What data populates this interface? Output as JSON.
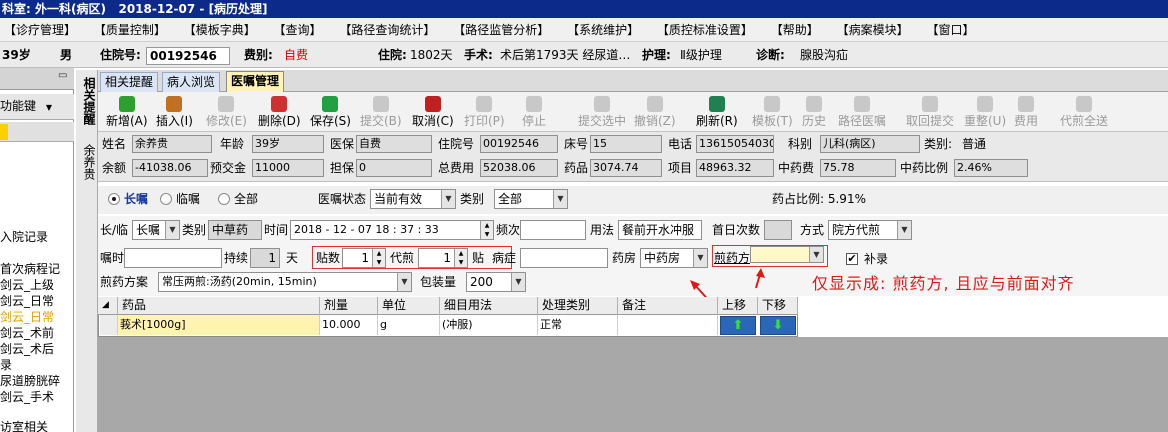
{
  "window": {
    "title": "科室: 外一科(病区)   2018-12-07 - [病历处理]"
  },
  "menu": [
    "【诊疗管理】",
    "【质量控制】",
    "【模板字典】",
    "【查询】",
    "【路径查询统计】",
    "【路径监管分析】",
    "【系统维护】",
    "【质控标准设置】",
    "【帮助】",
    "【病案模块】",
    "【窗口】"
  ],
  "patient": {
    "age": "39岁",
    "sex": "男",
    "admission_no_label": "住院号:",
    "admission_no": "00192546",
    "fee_type_label": "费别:",
    "fee_type": "自费",
    "stay_label": "住院:",
    "stay": "1802天",
    "surgery_label": "手术:",
    "surgery": "术后第1793天  经尿道…",
    "nursing_label": "护理:",
    "nursing": "Ⅱ级护理",
    "diagnosis_label": "诊断:",
    "diagnosis": "腺股沟疝"
  },
  "left": {
    "function_key": "功能键",
    "items": [
      "入院记录",
      "首次病程记",
      "剑云_上级",
      "剑云_日常",
      "剑云_日常",
      "剑云_术前",
      "剑云_术后",
      "录",
      "尿道膀胱碎",
      "剑云_手术",
      "访室相关"
    ]
  },
  "vtabs": {
    "tab1": "相关提醒",
    "tab2": "余养贵"
  },
  "tabs": [
    "相关提醒",
    "病人浏览",
    "医嘱管理"
  ],
  "toolbar": [
    {
      "label": "新增(A)",
      "enabled": true,
      "color": "#2ea02e"
    },
    {
      "label": "插入(I)",
      "enabled": true,
      "color": "#c07020"
    },
    {
      "label": "修改(E)",
      "enabled": false
    },
    {
      "label": "删除(D)",
      "enabled": true,
      "color": "#d03030"
    },
    {
      "label": "保存(S)",
      "enabled": true,
      "color": "#20a040"
    },
    {
      "label": "提交(B)",
      "enabled": false
    },
    {
      "label": "取消(C)",
      "enabled": true,
      "color": "#c02020"
    },
    {
      "label": "打印(P)",
      "enabled": false
    },
    {
      "label": "停止",
      "enabled": false
    },
    {
      "label": "提交选中",
      "enabled": false
    },
    {
      "label": "撤销(Z)",
      "enabled": false
    },
    {
      "label": "刷新(R)",
      "enabled": true,
      "color": "#208050"
    },
    {
      "label": "模板(T)",
      "enabled": false
    },
    {
      "label": "历史",
      "enabled": false
    },
    {
      "label": "路径医嘱",
      "enabled": false
    },
    {
      "label": "取回提交",
      "enabled": false
    },
    {
      "label": "重整(U)",
      "enabled": false
    },
    {
      "label": "费用",
      "enabled": false
    },
    {
      "label": "代煎全送",
      "enabled": false
    }
  ],
  "info": {
    "name_label": "姓名",
    "name": "余养贵",
    "age_label": "年龄",
    "age": "39岁",
    "insurance_label": "医保",
    "insurance": "自费",
    "admission_label": "住院号",
    "admission": "00192546",
    "bed_label": "床号",
    "bed": "15",
    "phone_label": "电话",
    "phone": "13615054030",
    "dept_label": "科别",
    "dept": "儿科(病区)",
    "category_label": "类别:",
    "category": "普通",
    "balance_label": "余额",
    "balance": "-41038.06",
    "deposit_label": "预交金",
    "deposit": "11000",
    "guarantee_label": "担保",
    "guarantee": "0",
    "total_label": "总费用",
    "total": "52038.06",
    "drug_label": "药品",
    "drug": "3074.74",
    "item_label": "项目",
    "item": "48963.32",
    "tcm_label": "中药费",
    "tcm": "75.78",
    "tcm_ratio_label": "中药比例",
    "tcm_ratio": "2.46%"
  },
  "filter": {
    "long_term": "长嘱",
    "temporary": "临嘱",
    "all": "全部",
    "status_label": "医嘱状态",
    "status": "当前有效",
    "type_label": "类别",
    "type": "全部",
    "drug_ratio": "药占比例: 5.91%"
  },
  "edit": {
    "long_temp_label": "长/临",
    "long_temp": "长嘱",
    "class_label": "类别",
    "class": "中草药",
    "time_label": "时间",
    "time": "2018 - 12 - 07   18 : 37 : 33",
    "frequency_label": "频次",
    "frequency": "",
    "usage_label": "用法",
    "usage": "餐前开水冲服",
    "first_day_label": "首日次数",
    "first_day": "",
    "method_label": "方式",
    "method": "院方代煎",
    "entrust_label": "嘱时",
    "entrust": "",
    "duration_label": "持续",
    "duration": "1",
    "duration_unit": "天",
    "doses_label": "贴数",
    "doses": "1",
    "decoct_label": "代煎",
    "decoct": "1",
    "decoct_unit": "贴",
    "disease_label": "病症",
    "disease": "",
    "pharmacy_label": "药房",
    "pharmacy": "中药房",
    "decoct_method_label": "煎药方",
    "decoct_method": "",
    "supplement_label": "补录",
    "supplement_checked": "✔",
    "recipe_label": "煎药方案",
    "recipe": "常压两煎:汤药(20min, 15min)",
    "package_label": "包装量",
    "package": "200"
  },
  "annotation": "仅显示成: 煎药方, 且应与前面对齐",
  "grid": {
    "columns": [
      "药品",
      "剂量",
      "单位",
      "细目用法",
      "处理类别",
      "备注",
      "上移",
      "下移"
    ],
    "rows": [
      {
        "drug": "莪术[1000g]",
        "dose": "10.000",
        "unit": "g",
        "usage": "(冲服)",
        "type": "正常",
        "note": ""
      }
    ]
  }
}
